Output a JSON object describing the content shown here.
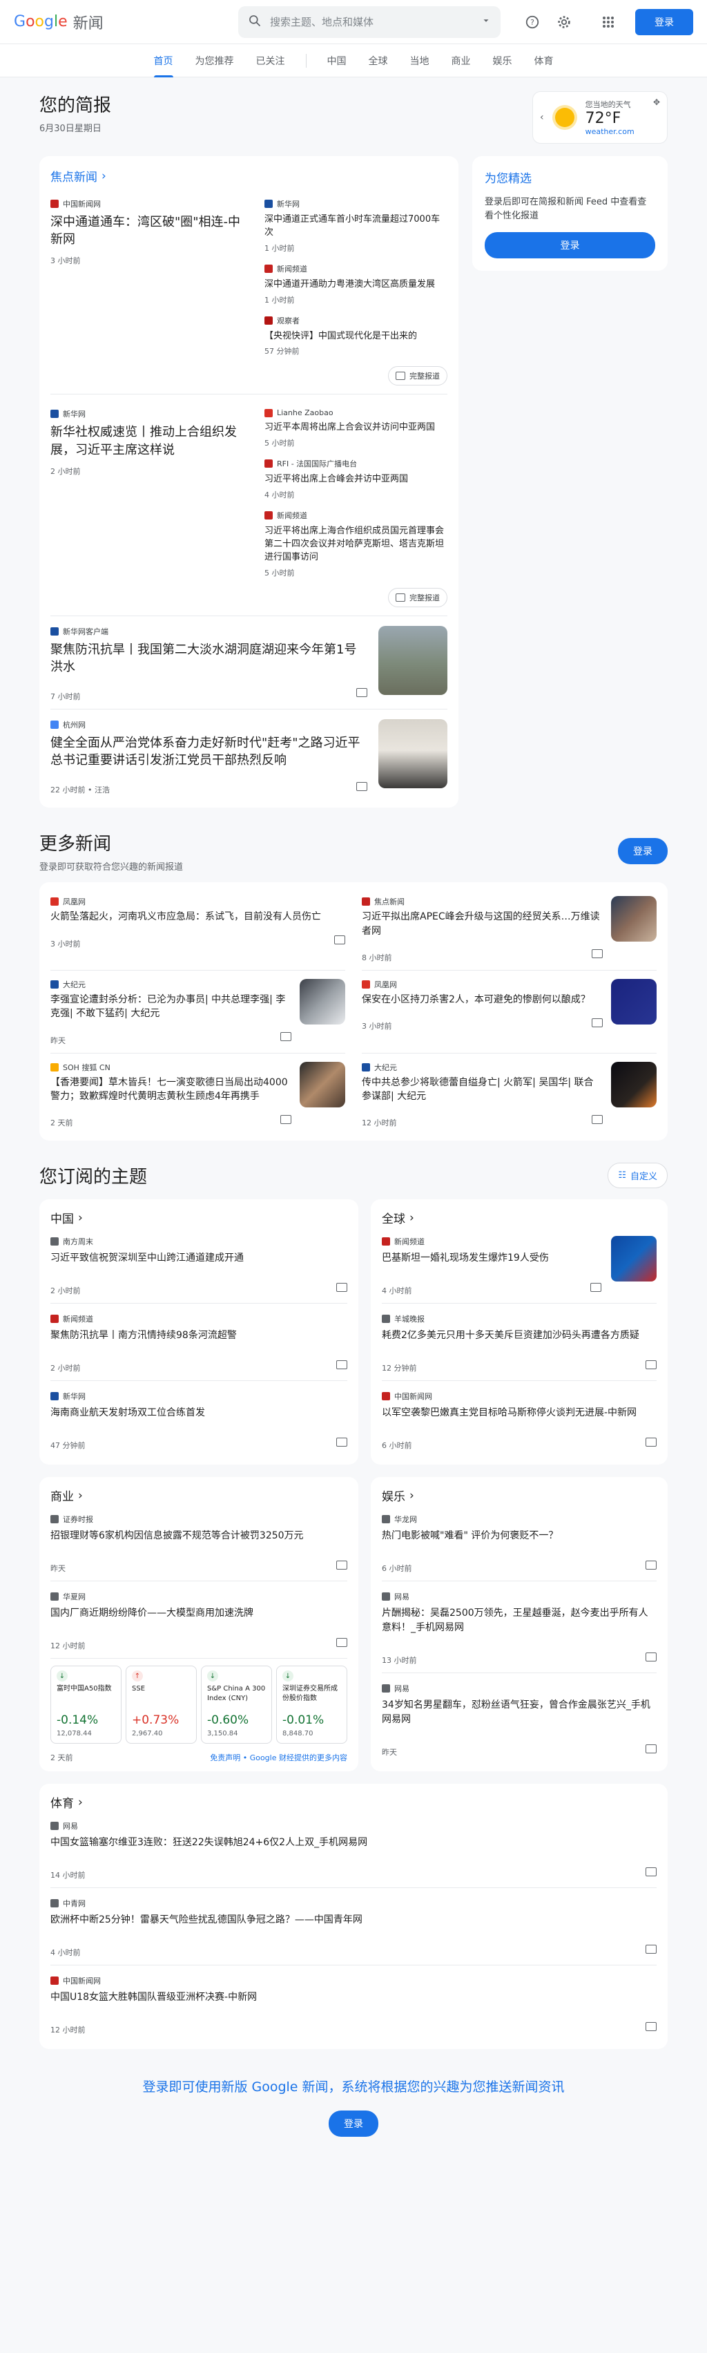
{
  "header": {
    "logo_word": "Google",
    "logo_product": "新闻",
    "search_placeholder": "搜索主题、地点和媒体",
    "login_label": "登录"
  },
  "nav": {
    "items": [
      {
        "label": "首页",
        "active": true
      },
      {
        "label": "为您推荐",
        "active": false
      },
      {
        "label": "已关注",
        "active": false
      }
    ],
    "sections": [
      "中国",
      "全球",
      "当地",
      "商业",
      "娱乐",
      "体育"
    ]
  },
  "brief": {
    "title": "您的简报",
    "date": "6月30日星期日"
  },
  "weather": {
    "label": "您当地的天气",
    "temp": "72°F",
    "source": "weather.com"
  },
  "headlines": {
    "title": "焦点新闻",
    "full_coverage_label": "完整报道",
    "clusters": [
      {
        "main": {
          "source": "中国新闻网",
          "title": "深中通道通车：湾区破\"圈\"相连-中新网",
          "time": "3 小时前",
          "color": "#c5221f"
        },
        "subs": [
          {
            "source": "新华网",
            "title": "深中通道正式通车首小时车流量超过7000车次",
            "time": "1 小时前",
            "color": "#1a4fa0"
          },
          {
            "source": "新闻频道",
            "title": "深中通道开通助力粤港澳大湾区高质量发展",
            "time": "1 小时前",
            "color": "#c5221f"
          },
          {
            "source": "观察者",
            "title": "【央视快评】中国式现代化是干出来的",
            "time": "57 分钟前",
            "color": "#b31412"
          }
        ]
      },
      {
        "main": {
          "source": "新华网",
          "title": "新华社权威速览丨推动上合组织发展，习近平主席这样说",
          "time": "2 小时前",
          "color": "#1a4fa0"
        },
        "subs": [
          {
            "source": "Lianhe Zaobao",
            "title": "习近平本周将出席上合会议并访问中亚两国",
            "time": "5 小时前",
            "color": "#d93025"
          },
          {
            "source": "RFI - 法国国际广播电台",
            "title": "习近平将出席上合峰会并访中亚两国",
            "time": "4 小时前",
            "color": "#c5221f"
          },
          {
            "source": "新闻频道",
            "title": "习近平将出席上海合作组织成员国元首理事会第二十四次会议并对哈萨克斯坦、塔吉克斯坦进行国事访问",
            "time": "5 小时前",
            "color": "#c5221f"
          }
        ]
      }
    ],
    "items": [
      {
        "source": "新华网客户端",
        "title": "聚焦防汛抗旱丨我国第二大淡水湖洞庭湖迎来今年第1号洪水",
        "time": "7 小时前",
        "color": "#1a4fa0",
        "thumb": "linear-gradient(180deg,#9aa7b0 0%,#7d8a7a 55%,#6a6e5d 100%)"
      },
      {
        "source": "杭州网",
        "title": "健全全面从严治党体系奋力走好新时代\"赶考\"之路习近平总书记重要讲话引发浙江党员干部热烈反响",
        "time": "22 小时前 • 汪浩",
        "color": "#4285f4",
        "thumb": "linear-gradient(180deg,#d8d4cc 0%,#e9e5de 45%,#3b3a38 100%)"
      }
    ]
  },
  "sidebar": {
    "title": "为您精选",
    "desc": "登录后即可在简报和新闻 Feed 中查看查看个性化报道",
    "button": "登录"
  },
  "more_news": {
    "title": "更多新闻",
    "subtitle": "登录即可获取符合您兴趣的新闻报道",
    "login_label": "登录",
    "items": [
      {
        "source": "凤凰网",
        "title": "火箭坠落起火，河南巩义市应急局：系试飞，目前没有人员伤亡",
        "time": "3 小时前",
        "thumb": "",
        "color": "#d93025"
      },
      {
        "source": "焦点新闻",
        "title": "习近平拟出席APEC峰会升级与这国的经贸关系…万维读者网",
        "time": "8 小时前",
        "thumb": "linear-gradient(135deg,#2b3b55,#8a6b5a 50%,#c9b39d)",
        "color": "#c5221f"
      },
      {
        "source": "大纪元",
        "title": "李强宣论遭封杀分析：已沦为办事员| 中共总理李强| 李克强| 不敢下猛药| 大纪元",
        "time": "昨天",
        "thumb": "linear-gradient(135deg,#3c4048,#9aa0a6 50%,#e8eaed)",
        "color": "#1a4fa0"
      },
      {
        "source": "凤凰网",
        "title": "保安在小区持刀杀害2人，本可避免的惨剧何以酿成？",
        "time": "3 小时前",
        "thumb": "linear-gradient(135deg,#1a237e,#283593)",
        "color": "#d93025"
      },
      {
        "source": "SOH 搜狐 CN",
        "title": "【香港要闻】草木皆兵！七一演变歌德日当局出动4000警力；致歉辉煌时代黄明志黄秋生顾虑4年再携手",
        "time": "2 天前",
        "thumb": "linear-gradient(135deg,#2a2a2a,#b08a6a 50%,#4a3a30)",
        "color": "#f9ab00"
      },
      {
        "source": "大纪元",
        "title": "传中共总参少将耿德蕾自缢身亡| 火箭军| 吴国华| 联合参谋部| 大纪元",
        "time": "12 小时前",
        "thumb": "linear-gradient(135deg,#0b0b12,#2a2420 60%,#e07a2a)",
        "color": "#1a4fa0"
      }
    ]
  },
  "subscribed": {
    "title": "您订阅的主题",
    "customize_label": "自定义",
    "topics": [
      {
        "title": "中国",
        "items": [
          {
            "source": "南方周末",
            "title": "习近平致信祝贺深圳至中山跨江通道建成开通",
            "time": "2 小时前",
            "thumb": "",
            "color": "#5f6368"
          },
          {
            "source": "新闻频道",
            "title": "聚焦防汛抗旱丨南方汛情持续98条河流超警",
            "time": "2 小时前",
            "thumb": "",
            "color": "#c5221f"
          },
          {
            "source": "新华网",
            "title": "海南商业航天发射场双工位合练首发",
            "time": "47 分钟前",
            "thumb": "",
            "color": "#1a4fa0"
          }
        ]
      },
      {
        "title": "全球",
        "items": [
          {
            "source": "新闻频道",
            "title": "巴基斯坦一婚礼现场发生爆炸19人受伤",
            "time": "4 小时前",
            "thumb": "linear-gradient(135deg,#0d47a1,#1565c0 50%,#c62828)",
            "color": "#c5221f"
          },
          {
            "source": "羊城晚报",
            "title": "耗费2亿多美元只用十多天美斥巨资建加沙码头再遭各方质疑",
            "time": "12 分钟前",
            "thumb": "",
            "color": "#5f6368"
          },
          {
            "source": "中国新闻网",
            "title": "以军空袭黎巴嫩真主党目标哈马斯称停火谈判无进展-中新网",
            "time": "6 小时前",
            "thumb": "",
            "color": "#c5221f"
          }
        ]
      },
      {
        "title": "商业",
        "items": [
          {
            "source": "证券时报",
            "title": "招银理财等6家机构因信息披露不规范等合计被罚3250万元",
            "time": "昨天",
            "thumb": "",
            "color": "#5f6368"
          },
          {
            "source": "华夏网",
            "title": "国内厂商近期纷纷降价——大模型商用加速洗牌",
            "time": "12 小时前",
            "thumb": "",
            "color": "#5f6368"
          }
        ],
        "stocks": [
          {
            "name": "富时中国A50指数",
            "change": "-0.14%",
            "value": "12,078.44",
            "dir": "down"
          },
          {
            "name": "SSE",
            "change": "+0.73%",
            "value": "2,967.40",
            "dir": "up"
          },
          {
            "name": "S&P China A 300 Index (CNY)",
            "change": "-0.60%",
            "value": "3,150.84",
            "dir": "down"
          },
          {
            "name": "深圳证券交易所成份股价指数",
            "change": "-0.01%",
            "value": "8,848.70",
            "dir": "down"
          }
        ],
        "stock_time": "2 天前",
        "disclaimer": "免责声明 • Google 财经提供的更多内容"
      },
      {
        "title": "娱乐",
        "items": [
          {
            "source": "华龙网",
            "title": "热门电影被喊\"难看\" 评价为何褒贬不一？",
            "time": "6 小时前",
            "thumb": "",
            "color": "#5f6368"
          },
          {
            "source": "网易",
            "title": "片酬揭秘：吴磊2500万领先，王星越垂涎，赵今麦出乎所有人意料！_手机网易网",
            "time": "13 小时前",
            "thumb": "",
            "color": "#5f6368"
          },
          {
            "source": "网易",
            "title": "34岁知名男星翻车，怼粉丝语气狂妄，曾合作金晨张艺兴_手机网易网",
            "time": "昨天",
            "thumb": "",
            "color": "#5f6368"
          }
        ]
      }
    ],
    "sports": {
      "title": "体育",
      "items": [
        {
          "source": "网易",
          "title": "中国女篮输塞尔维亚3连败：狂送22失误韩旭24+6仅2人上双_手机网易网",
          "time": "14 小时前",
          "color": "#5f6368"
        },
        {
          "source": "中青网",
          "title": "欧洲杯中断25分钟！雷暴天气险些扰乱德国队争冠之路？——中国青年网",
          "time": "4 小时前",
          "color": "#5f6368"
        },
        {
          "source": "中国新闻网",
          "title": "中国U18女篮大胜韩国队晋级亚洲杯决赛-中新网",
          "time": "12 小时前",
          "color": "#c5221f"
        }
      ]
    }
  },
  "bottom": {
    "headline": "登录即可使用新版 Google 新闻，系统将根据您的兴趣为您推送新闻资讯",
    "button": "登录"
  },
  "colors": {
    "accent": "#1a73e8",
    "down": "#137333",
    "up": "#d93025"
  }
}
